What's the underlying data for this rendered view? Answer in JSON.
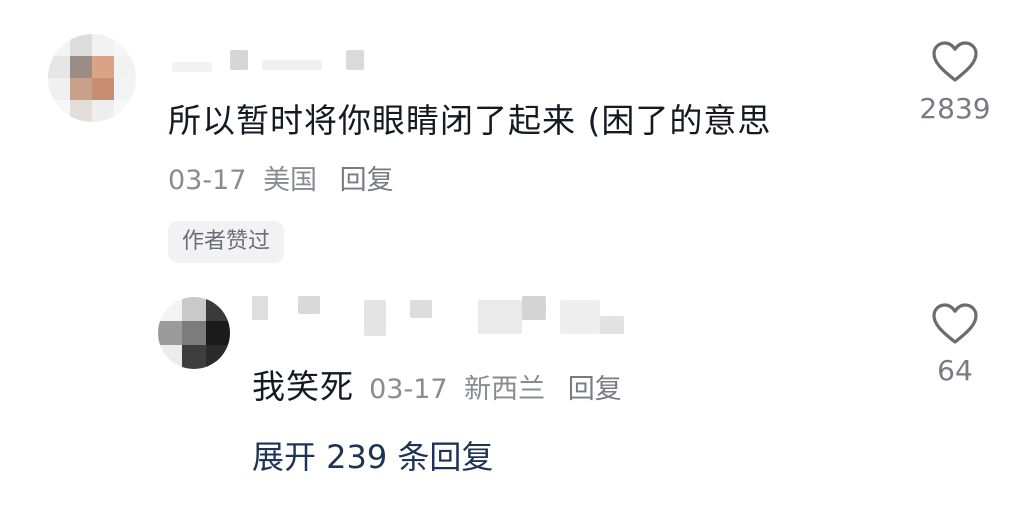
{
  "comment": {
    "text": "所以暂时将你眼睛闭了起来 (困了的意思",
    "date": "03-17",
    "location": "美国",
    "reply_label": "回复",
    "author_liked_badge": "作者赞过",
    "like_count": "2839",
    "like_icon": "heart-outline-icon"
  },
  "reply": {
    "text": "我笑死",
    "date": "03-17",
    "location": "新西兰",
    "reply_label": "回复",
    "like_count": "64",
    "like_icon": "heart-outline-icon"
  },
  "expand_replies": {
    "label": "展开 239 条回复"
  },
  "colors": {
    "primary_text": "#161823",
    "secondary_text": "#8a8b91",
    "link_blue": "#1e3457",
    "badge_bg": "#f2f2f4"
  }
}
